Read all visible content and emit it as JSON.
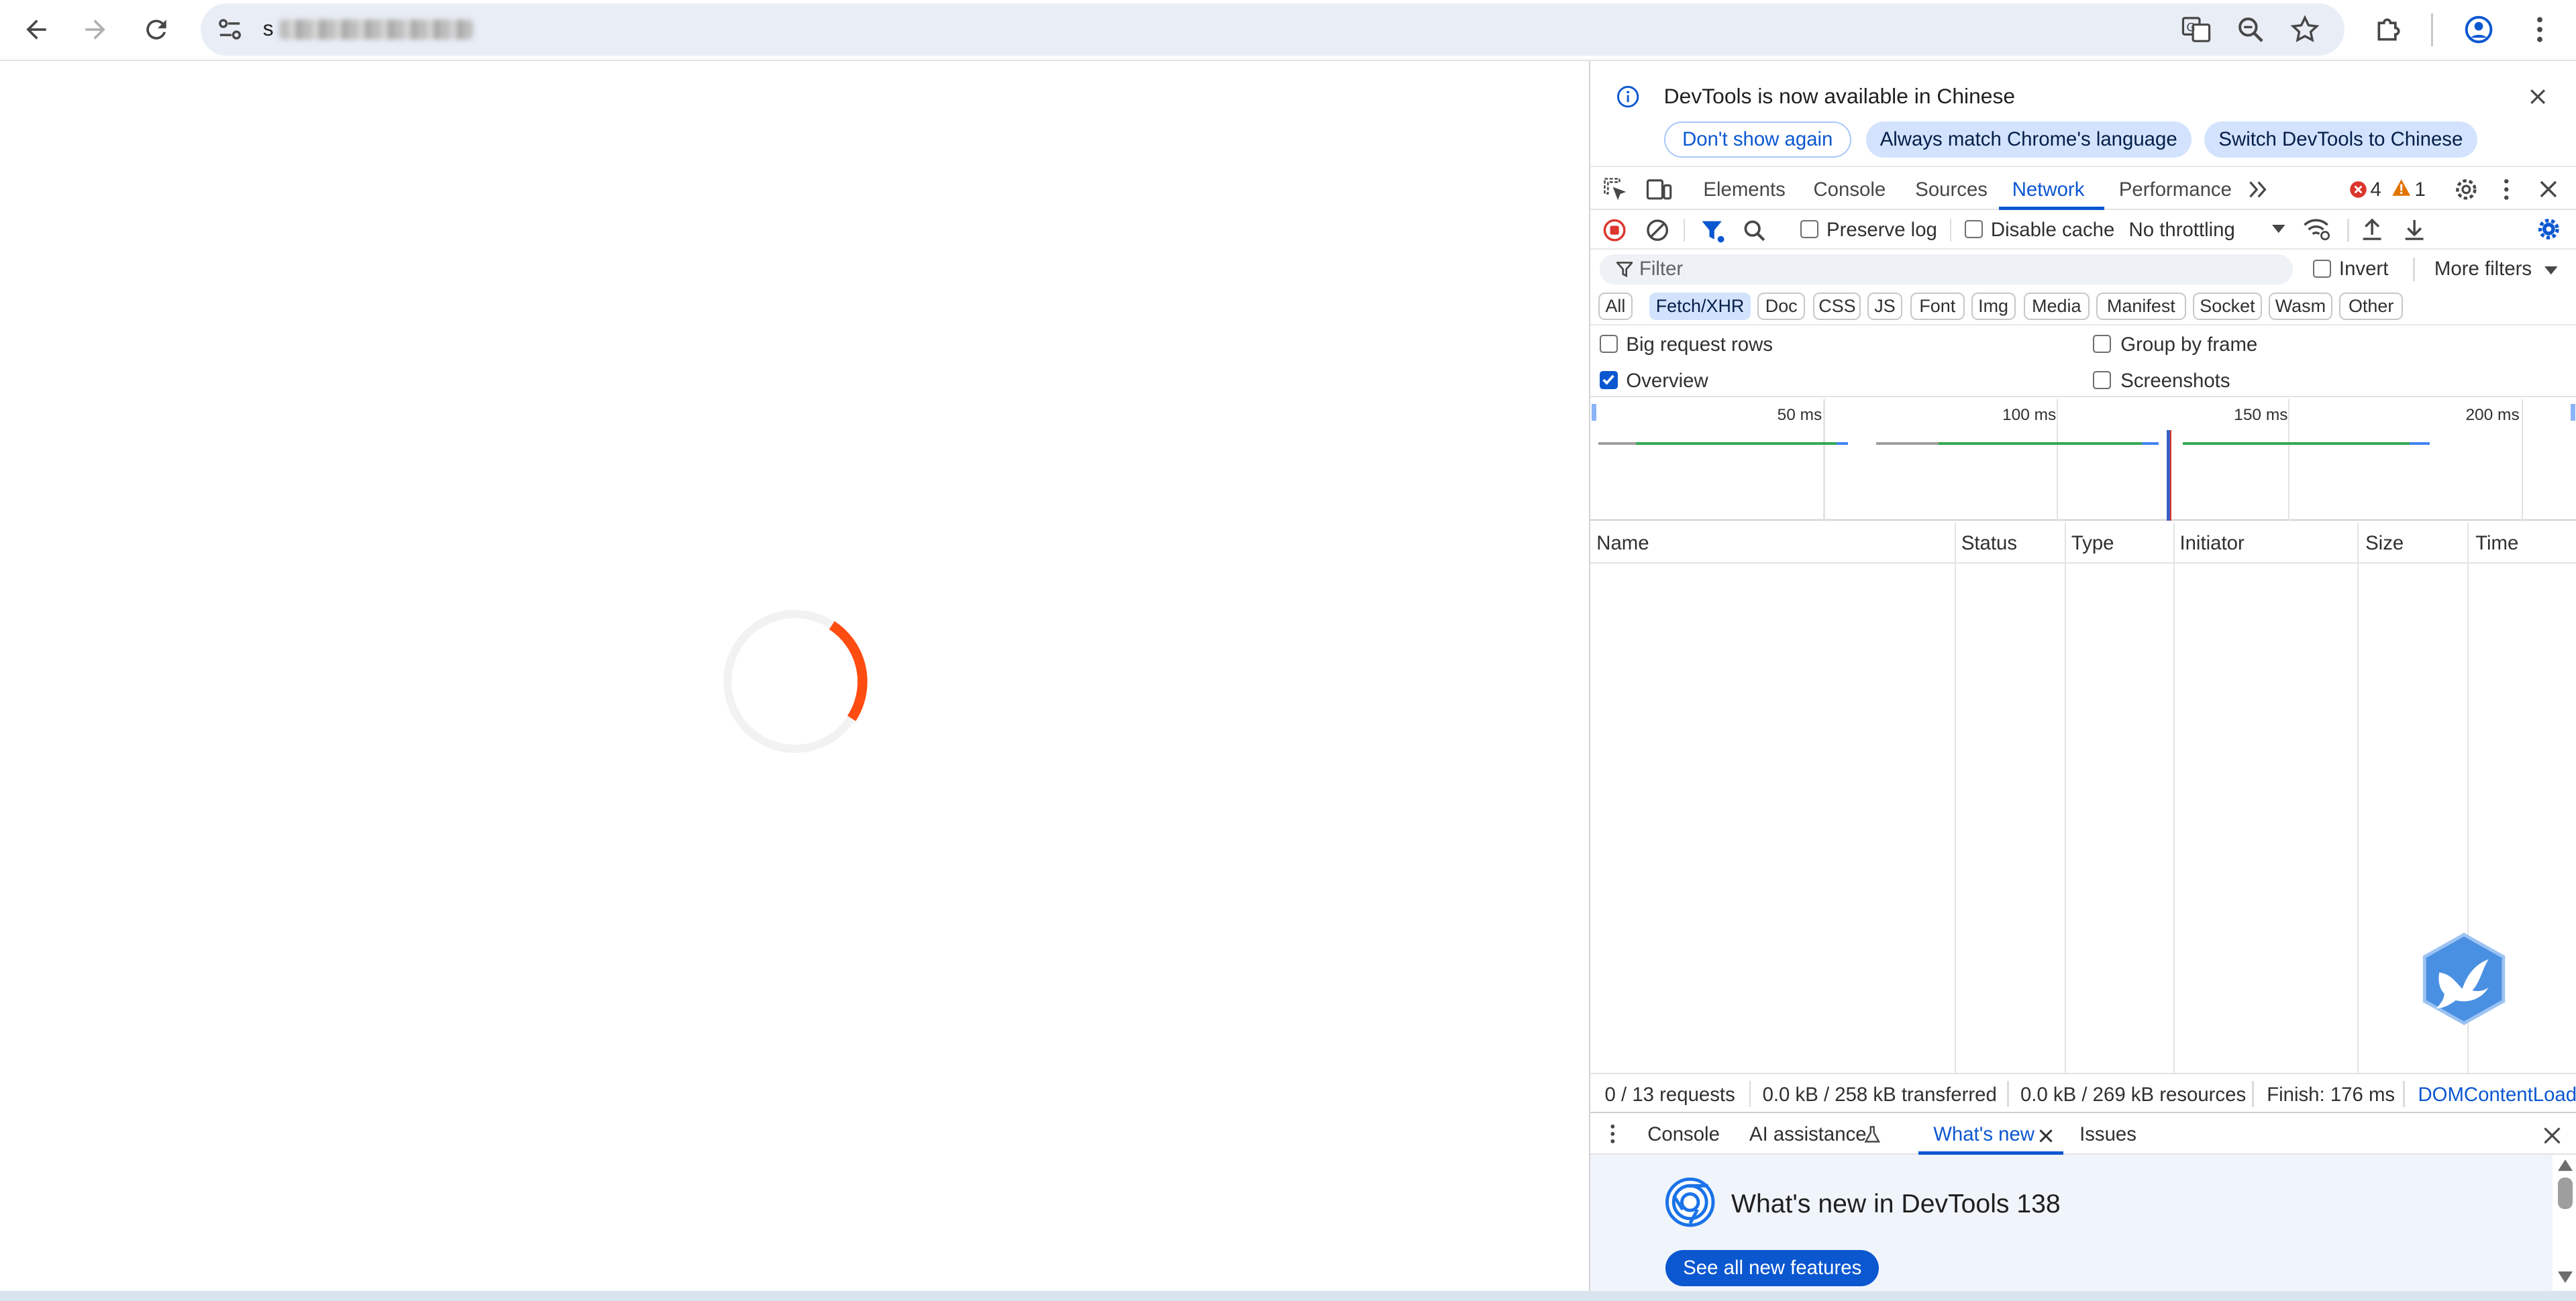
{
  "browser": {
    "url_prefix": "s",
    "colors": {
      "accent": "#0b57d0",
      "spinner": "#ff4d12"
    }
  },
  "devtools": {
    "infobar": {
      "message": "DevTools is now available in Chinese",
      "dont_show": "Don't show again",
      "always_match": "Always match Chrome's language",
      "switch": "Switch DevTools to Chinese"
    },
    "tabs": [
      "Elements",
      "Console",
      "Sources",
      "Network",
      "Performance"
    ],
    "error_count": "4",
    "warning_count": "1",
    "netbar": {
      "preserve_log": "Preserve log",
      "disable_cache": "Disable cache",
      "throttling": "No throttling"
    },
    "filter": {
      "placeholder": "Filter",
      "invert": "Invert",
      "more_filters": "More filters"
    },
    "types": [
      "All",
      "Fetch/XHR",
      "Doc",
      "CSS",
      "JS",
      "Font",
      "Img",
      "Media",
      "Manifest",
      "Socket",
      "Wasm",
      "Other"
    ],
    "options": {
      "big_rows": "Big request rows",
      "group_by_frame": "Group by frame",
      "overview": "Overview",
      "screenshots": "Screenshots"
    },
    "overview_ticks": [
      "50 ms",
      "100 ms",
      "150 ms",
      "200 ms"
    ],
    "columns": [
      "Name",
      "Status",
      "Type",
      "Initiator",
      "Size",
      "Time"
    ],
    "status": {
      "requests": "0 / 13 requests",
      "transferred": "0.0 kB / 258 kB transferred",
      "resources": "0.0 kB / 269 kB resources",
      "finish": "Finish: 176 ms",
      "dcl": "DOMContentLoad"
    },
    "drawer_tabs": {
      "console": "Console",
      "ai": "AI assistance",
      "whats_new": "What's new",
      "issues": "Issues"
    },
    "whats_new": {
      "title": "What's new in DevTools 138",
      "button": "See all new features"
    }
  }
}
